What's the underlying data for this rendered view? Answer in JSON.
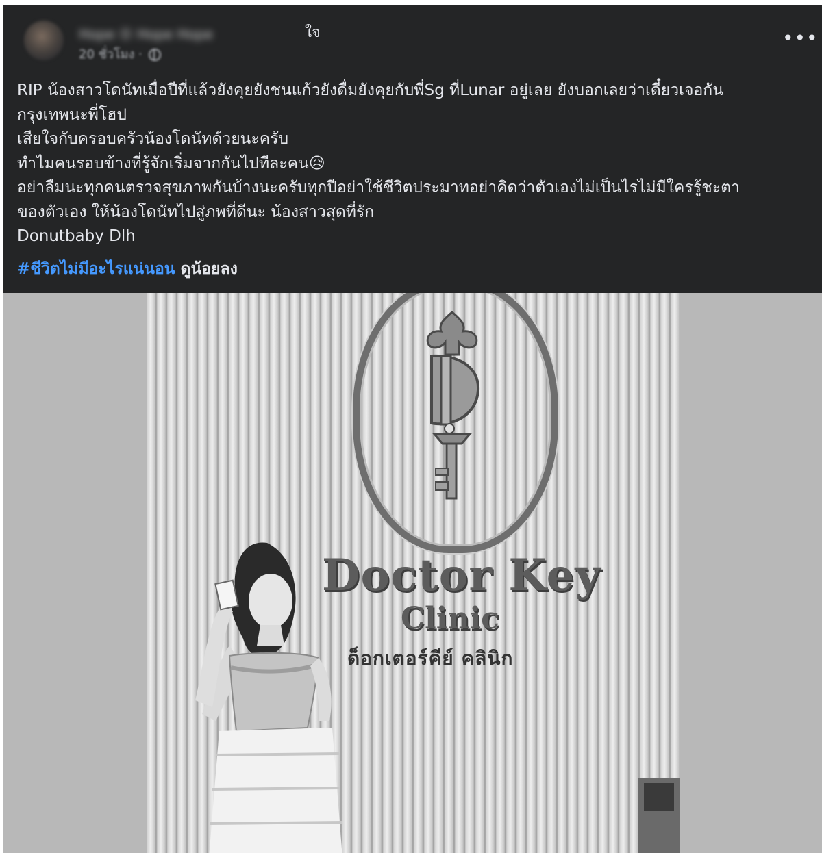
{
  "post": {
    "author_blurred": "Hope Ⓞ Hope Hope",
    "author_tail": "ใจ",
    "time_blurred": "20 ชั่วโมง · ",
    "more_label": "•••",
    "body_lines": [
      "RIP น้องสาวโดนัทเมื่อปีที่แล้วยังคุยยังชนแก้วยังดื่มยังคุยกับพี่Sg ที่Lunar อยู่เลย ยังบอกเลยว่าเดี๋ยวเจอกัน\nกรุงเทพนะพี่โฮป",
      "เสียใจกับครอบครัวน้องโดนัทด้วยนะครับ",
      "ทำไมคนรอบข้างที่รู้จักเริ่มจากกันไปทีละคน😥",
      "อย่าลืมนะทุกคนตรวจสุขภาพกันบ้างนะครับทุกปีอย่าใช้ชีวิตประมาทอย่าคิดว่าตัวเองไม่เป็นไรไม่มีใครรู้ชะตา\nของตัวเอง ให้น้องโดนัทไปสู่ภพที่ดีนะ น้องสาวสุดที่รัก",
      "Donutbaby Dlh"
    ],
    "hashtag": "#ชีวิตไม่มีอะไรแน่นอน",
    "see_less": "ดูน้อยลง"
  },
  "photo": {
    "sign_line1": "Doctor Key",
    "sign_line2": "Clinic",
    "sign_line3": "ด็อกเตอร์คีย์ คลินิก"
  },
  "colors": {
    "card_bg": "#242526",
    "text": "#e4e6eb",
    "secondary": "#b0b3b8",
    "link": "#4599ff"
  }
}
